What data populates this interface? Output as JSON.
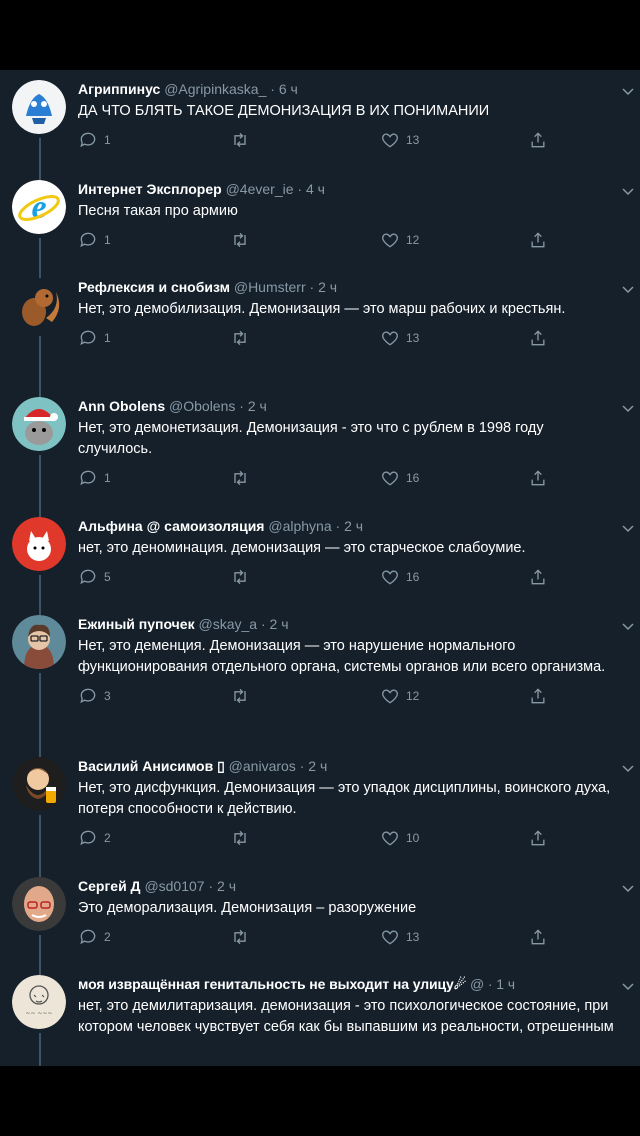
{
  "tweets": [
    {
      "name": "Агриппинус",
      "handle": "@Agripinkaska_",
      "time": "6 ч",
      "text": "ДА ЧТО БЛЯТЬ ТАКОЕ ДЕМОНИЗАЦИЯ В ИХ ПОНИМАНИИ",
      "replies": "1",
      "retweets": "",
      "likes": "13",
      "avatar": "blue-bird-doll-avatar"
    },
    {
      "name": "Интернет Эксплорер",
      "handle": "@4ever_ie",
      "time": "4 ч",
      "text": "Песня такая про армию",
      "replies": "1",
      "retweets": "",
      "likes": "12",
      "avatar": "internet-explorer-logo-avatar"
    },
    {
      "name": "Рефлексия и снобизм",
      "handle": "@Humsterr",
      "time": "2 ч",
      "text": "Нет, это демобилизация. Демонизация — это марш рабочих и крестьян.",
      "replies": "1",
      "retweets": "",
      "likes": "13",
      "avatar": "squirrel-avatar"
    },
    {
      "name": "Ann Obolens",
      "handle": "@Obolens",
      "time": "2 ч",
      "text": "Нет, это демонетизация. Демонизация - это что с рублем в 1998 году случилось.",
      "replies": "1",
      "retweets": "",
      "likes": "16",
      "avatar": "cat-santa-hat-avatar"
    },
    {
      "name": "Альфина @ самоизоляция",
      "handle": "@alphyna",
      "time": "2 ч",
      "text": "нет, это деноминация. демонизация — это старческое слабоумие.",
      "replies": "5",
      "retweets": "",
      "likes": "16",
      "avatar": "white-cat-red-avatar"
    },
    {
      "name": "Ежиный пупочек",
      "handle": "@skay_a",
      "time": "2 ч",
      "text": "Нет, это деменция. Демонизация — это нарушение нормального функционирования отдельного органа, системы органов или всего организма.",
      "replies": "3",
      "retweets": "",
      "likes": "12",
      "avatar": "woman-glasses-avatar"
    },
    {
      "name": "Василий Анисимов ▯",
      "handle": "@anivaros",
      "time": "2 ч",
      "text": "Нет, это дисфункция. Демонизация — это упадок дисциплины, воинского духа, потеря способности к действию.",
      "replies": "2",
      "retweets": "",
      "likes": "10",
      "avatar": "cartoon-beard-beer-avatar"
    },
    {
      "name": "Сергей Д",
      "handle": "@sd0107",
      "time": "2 ч",
      "text": "Это деморализация. Демонизация – разоружение",
      "replies": "2",
      "retweets": "",
      "likes": "13",
      "avatar": "bald-man-avatar"
    },
    {
      "name": "моя извращённая генитальность не выходит на улицу☄",
      "handle": "@",
      "time": "1 ч",
      "text": "нет, это демилитаризация. демонизация - это психологическое состояние, при котором человек чувствует себя как бы выпавшим из реальности, отрешенным",
      "replies": "",
      "retweets": "",
      "likes": "",
      "avatar": "doodle-sketch-avatar"
    }
  ],
  "colors": {
    "background": "#15202b",
    "text": "#ffffff",
    "secondary": "#8899a6",
    "thread_line": "#3d5466"
  }
}
